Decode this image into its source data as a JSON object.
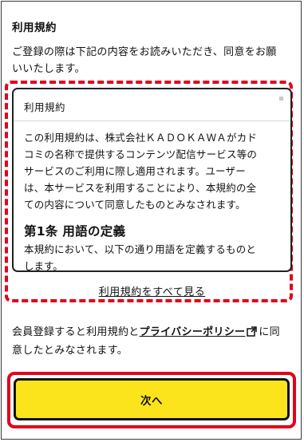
{
  "section": {
    "title": "利用規約",
    "intro_line1": "ご登録の際は下記の内容をお読みいただき、同意をお願",
    "intro_line2": "いいたします。"
  },
  "terms_box": {
    "title": "利用規約",
    "body_lines": [
      "この利用規約は、株式会社ＫＡＤＯＫＡＷＡがカド",
      "コミの名称で提供するコンテンツ配信サービス等の",
      "サービスのご利用に際し適用されます。ユーザー",
      "は、本サービスを利用することにより、本規約の全",
      "ての内容について同意したものとみなされます。"
    ],
    "article_heading": "第1条 用語の定義",
    "article_text": "本規約において、以下の通り用語を定義するものと",
    "article_text_cut": "します。"
  },
  "see_all_label": "利用規約をすべて見る",
  "consent": {
    "text_before": "会員登録すると利用規約と",
    "policy_link": "プライバシーポリシー",
    "text_after": "に同",
    "line2": "意したとみなされます。"
  },
  "next_button_label": "次へ",
  "colors": {
    "accent_button": "#fce41c",
    "highlight": "#e3001b"
  }
}
